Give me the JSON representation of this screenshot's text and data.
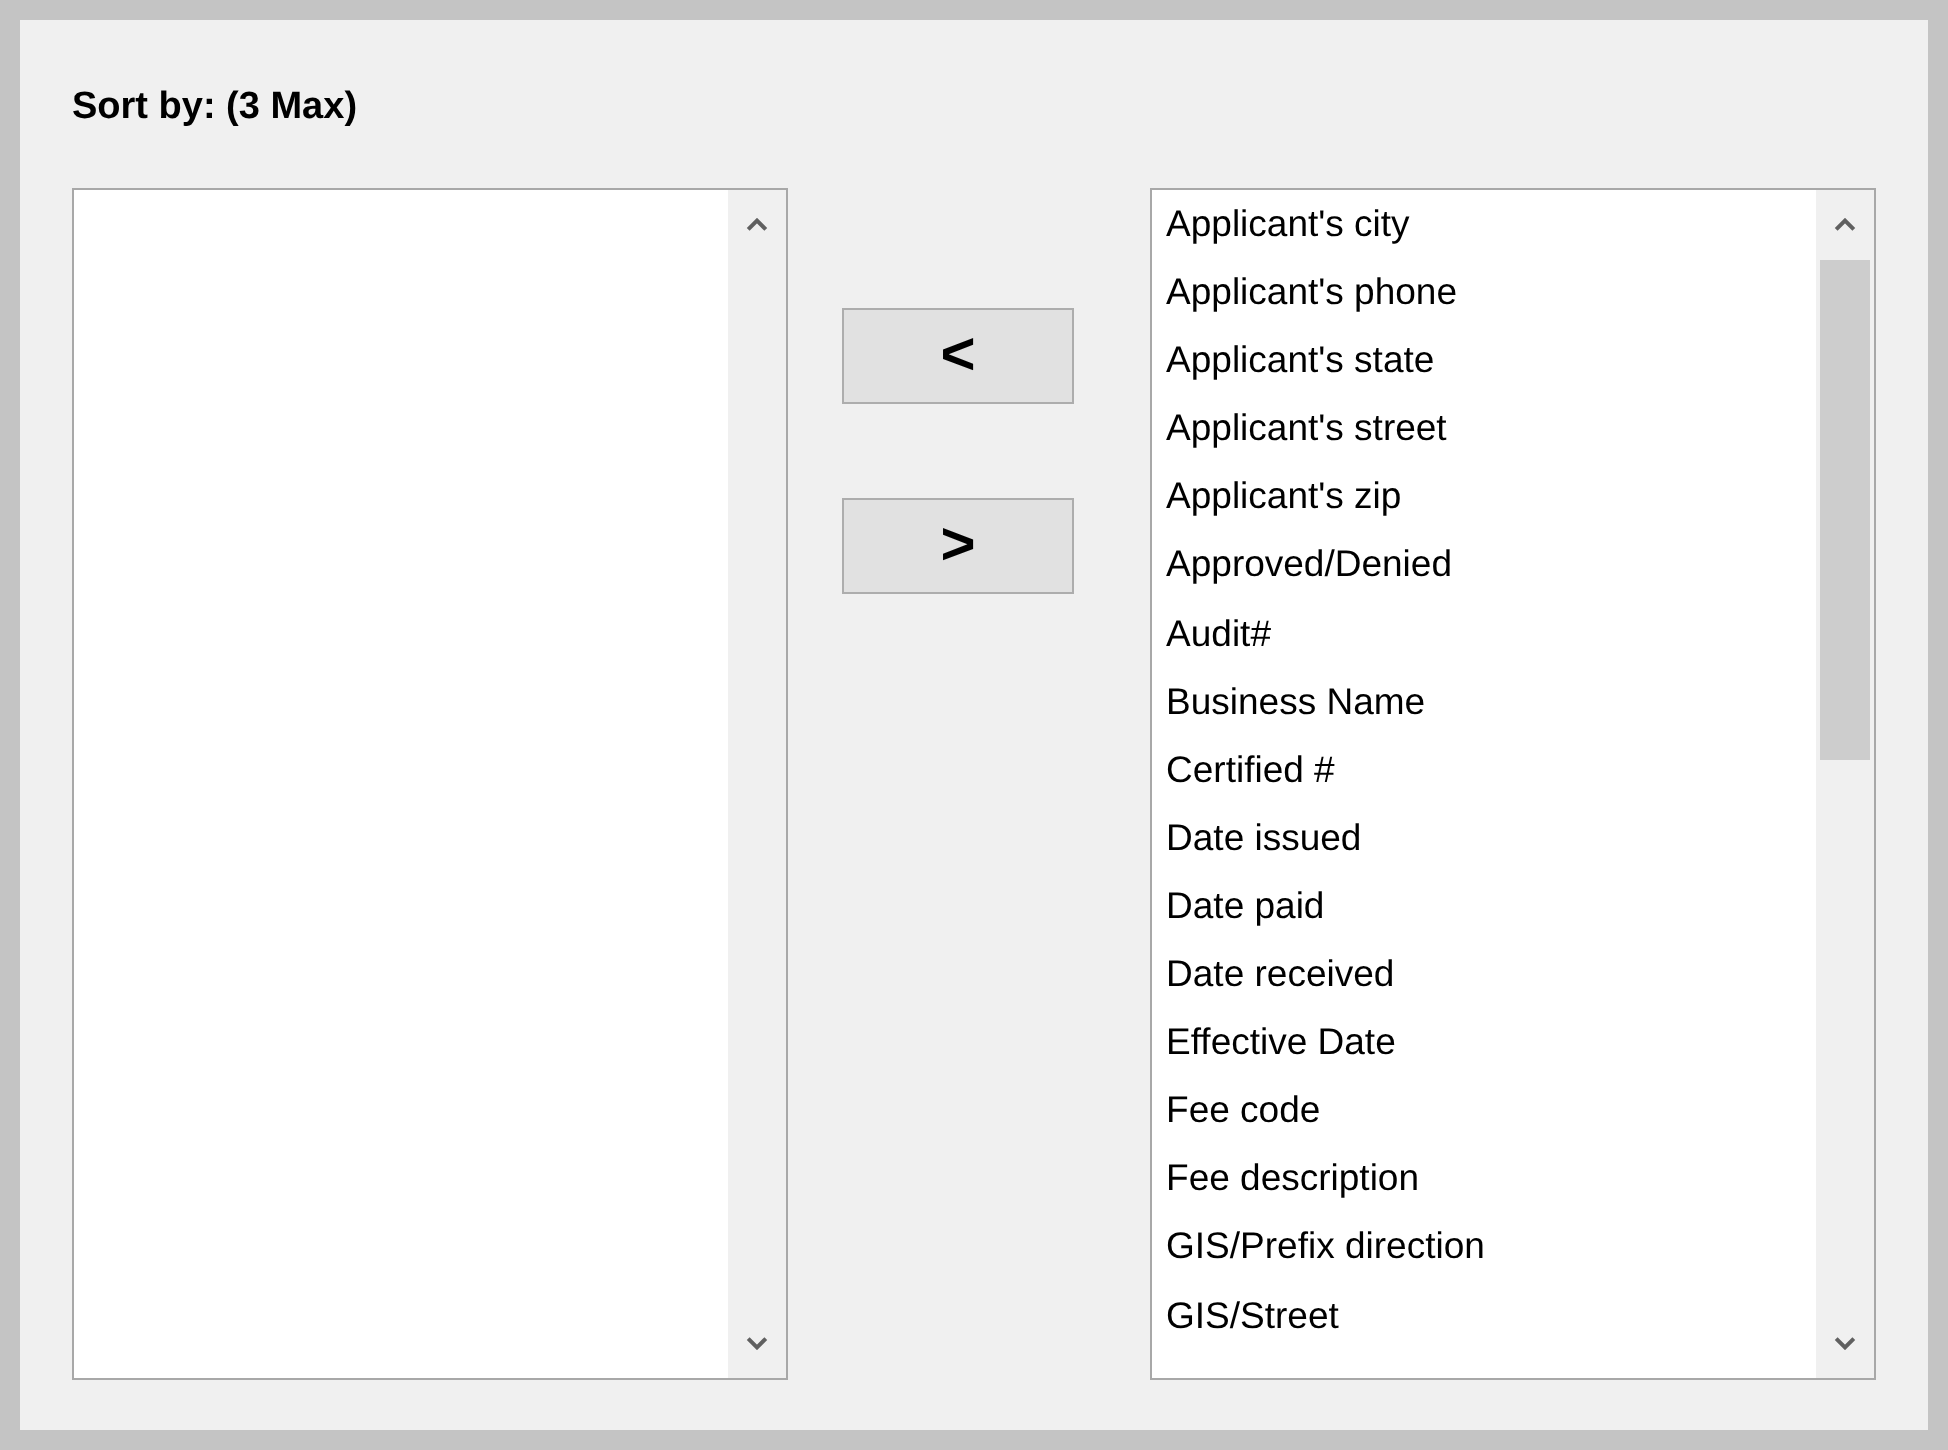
{
  "title": "Sort by: (3 Max)",
  "buttons": [
    {
      "label": "<"
    },
    {
      "label": ">"
    }
  ],
  "available_list": {
    "items": [
      {
        "label": "Applicant's city"
      },
      {
        "label": "Applicant's phone"
      },
      {
        "label": "Applicant's state"
      },
      {
        "label": "Applicant's street"
      },
      {
        "label": "Applicant's zip"
      },
      {
        "label": "Approved/Denied"
      },
      {
        "label": "Audit#"
      },
      {
        "label": "Business Name"
      },
      {
        "label": "Certified #"
      },
      {
        "label": "Date issued"
      },
      {
        "label": "Date paid"
      },
      {
        "label": "Date received"
      },
      {
        "label": "Effective Date"
      },
      {
        "label": "Fee code"
      },
      {
        "label": "Fee description"
      },
      {
        "label": "GIS/Prefix direction"
      },
      {
        "label": "GIS/Street"
      }
    ]
  }
}
